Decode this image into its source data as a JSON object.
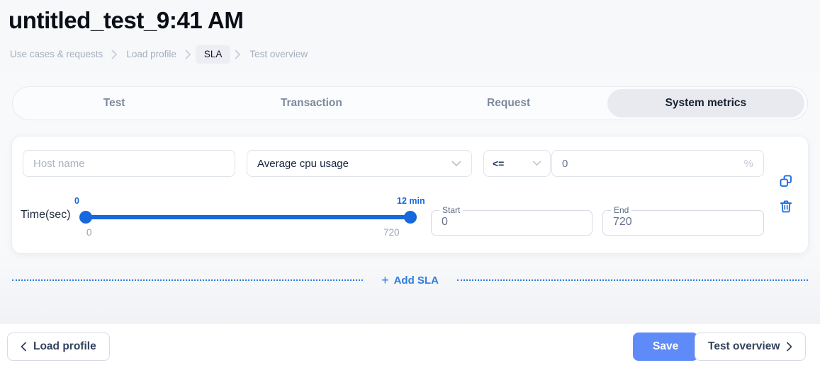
{
  "header": {
    "title": "untitled_test_9:41 AM"
  },
  "breadcrumb": {
    "items": [
      {
        "label": "Use cases & requests",
        "active": false
      },
      {
        "label": "Load profile",
        "active": false
      },
      {
        "label": "SLA",
        "active": true
      },
      {
        "label": "Test overview",
        "active": false
      }
    ]
  },
  "tabs": [
    {
      "label": "Test",
      "active": false
    },
    {
      "label": "Transaction",
      "active": false
    },
    {
      "label": "Request",
      "active": false
    },
    {
      "label": "System metrics",
      "active": true
    }
  ],
  "sla": {
    "host": {
      "placeholder": "Host name",
      "value": ""
    },
    "metric": {
      "value": "Average cpu usage",
      "icon": "chevron-down-icon"
    },
    "operator": {
      "value": "<=",
      "icon": "chevron-down-icon"
    },
    "threshold": {
      "value": "0",
      "suffix": "%"
    },
    "actions": {
      "copy_icon": "copy-icon",
      "delete_icon": "trash-icon"
    },
    "slider": {
      "label": "Time(sec)",
      "top_left_label": "0",
      "top_right_label": "12 min",
      "bottom_left_label": "0",
      "bottom_right_label": "720",
      "min": 0,
      "max": 720,
      "start": 0,
      "end": 720
    },
    "start_field": {
      "label": "Start",
      "value": "0"
    },
    "end_field": {
      "label": "End",
      "value": "720"
    }
  },
  "add_sla": {
    "plus": "+",
    "label": "Add SLA"
  },
  "footer": {
    "back": {
      "label": "Load profile",
      "icon": "chevron-left-icon"
    },
    "save": {
      "label": "Save"
    },
    "next": {
      "label": "Test overview",
      "icon": "chevron-right-icon"
    }
  },
  "colors": {
    "accent_blue": "#1668dc",
    "primary_button": "#5e8bf7",
    "link_blue": "#2f7ce0",
    "page_bg": "#f6f8fa",
    "active_tab_bg": "#e8eaef"
  }
}
